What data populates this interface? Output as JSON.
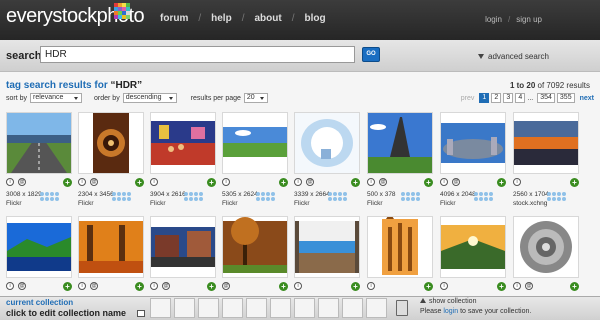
{
  "header": {
    "logo_text": "everystockphoto",
    "nav": [
      "forum",
      "help",
      "about",
      "blog"
    ],
    "account": [
      "login",
      "sign up"
    ]
  },
  "search": {
    "label": "search",
    "value": "HDR",
    "go_label": "GO",
    "advanced_label": "advanced search"
  },
  "results": {
    "title_prefix": "tag search results for ",
    "title_query": "“HDR”",
    "range": "1 to 20",
    "of_text": " of 7092 results"
  },
  "controls": {
    "sort_label": "sort by",
    "sort_value": "relevance",
    "order_label": "order by",
    "order_value": "descending",
    "perpage_label": "results per page",
    "perpage_value": "20"
  },
  "pager": {
    "prev": "prev",
    "pages": [
      "1",
      "2",
      "3",
      "4"
    ],
    "current": "1",
    "dots": "...",
    "last_pages": [
      "354",
      "355"
    ],
    "next": "next"
  },
  "photos": [
    {
      "dims": "3008 x 1829",
      "source": "Flickr",
      "scene": "road",
      "icons": [
        "i",
        "@"
      ]
    },
    {
      "dims": "2304 x 3456",
      "source": "Flickr",
      "scene": "stairs",
      "icons": [
        "i",
        "@"
      ]
    },
    {
      "dims": "3904 x 2616",
      "source": "Flickr",
      "scene": "crowd",
      "icons": [
        "i"
      ]
    },
    {
      "dims": "5305 x 2624",
      "source": "Flickr",
      "scene": "field",
      "icons": [
        "i"
      ]
    },
    {
      "dims": "3339 x 2664",
      "source": "Flickr",
      "scene": "snowroom",
      "icons": [
        "i",
        "@"
      ]
    },
    {
      "dims": "500 x 378",
      "source": "Flickr",
      "scene": "eiffel",
      "icons": [
        "i",
        "@"
      ]
    },
    {
      "dims": "4096 x 2048",
      "source": "Flickr",
      "scene": "panorama",
      "icons": [
        "i",
        "@"
      ]
    },
    {
      "dims": "2560 x 1704",
      "source": "stock.xchng",
      "scene": "sunset",
      "icons": [
        "i"
      ]
    },
    {
      "dims": "",
      "source": "",
      "scene": "lake",
      "icons": [
        "i",
        "@"
      ]
    },
    {
      "dims": "",
      "source": "",
      "scene": "autumn",
      "icons": [
        "i",
        "@"
      ]
    },
    {
      "dims": "",
      "source": "",
      "scene": "street",
      "icons": [
        "i",
        "@"
      ]
    },
    {
      "dims": "",
      "source": "",
      "scene": "forest",
      "icons": [
        "@"
      ]
    },
    {
      "dims": "",
      "source": "",
      "scene": "patio",
      "icons": [
        "i"
      ]
    },
    {
      "dims": "",
      "source": "",
      "scene": "cathedral",
      "icons": [
        "i"
      ]
    },
    {
      "dims": "",
      "source": "",
      "scene": "valley",
      "icons": [
        "i"
      ]
    },
    {
      "dims": "",
      "source": "",
      "scene": "spiral",
      "icons": [
        "i",
        "@"
      ]
    }
  ],
  "collection": {
    "title": "current collection",
    "edit": "click to edit collection name",
    "show": "show collection",
    "note_prefix": "Please ",
    "note_link": "login",
    "note_suffix": " to save your collection."
  },
  "colors": {
    "accent": "#1f6db5",
    "topbar": "#2e2e2e",
    "plus": "#3a8c20",
    "logo_grid": [
      "#e23a3a",
      "#f0a030",
      "#f3e048",
      "#52b848",
      "#3aa0e0",
      "#8f5ec8",
      "#e05fa8",
      "#38c0c0",
      "#f07a28",
      "#6ad04a",
      "#2d6fd0",
      "#d8d8d8",
      "#b03ab0",
      "#40b8e8",
      "#e8c020",
      "#7cd070"
    ]
  }
}
